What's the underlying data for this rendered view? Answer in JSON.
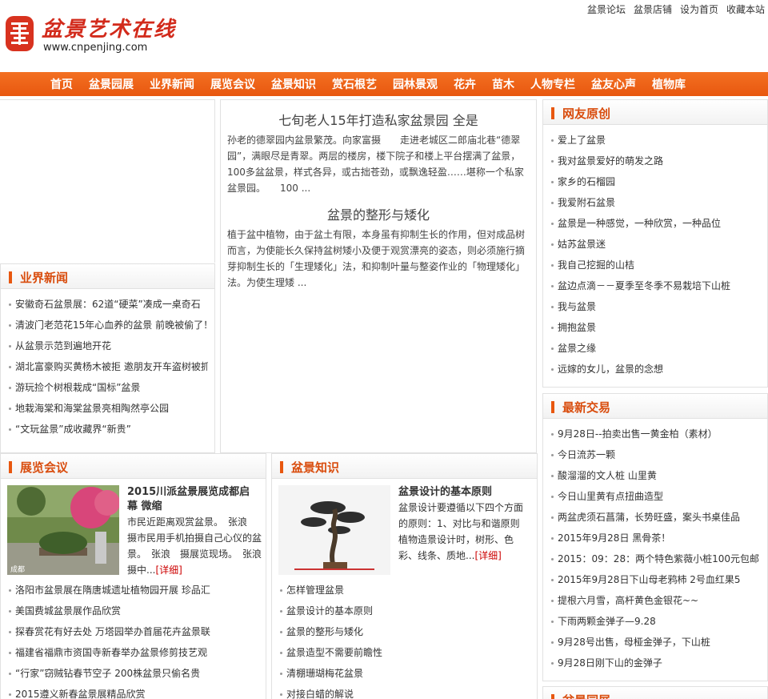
{
  "site": {
    "logo_text": "盆景艺术在线",
    "logo_url": "www.cnpenjing.com",
    "top_links": [
      "盆景论坛",
      "盆景店铺",
      "设为首页",
      "收藏本站"
    ]
  },
  "nav": [
    "首页",
    "盆景园展",
    "业界新闻",
    "展览会议",
    "盆景知识",
    "赏石根艺",
    "园林景观",
    "花卉",
    "苗木",
    "人物专栏",
    "盆友心声",
    "植物库"
  ],
  "center": {
    "articles": [
      {
        "title": "七旬老人15年打造私家盆景园  全是",
        "body": "孙老的德翠园内盆景繁茂。向家富摄　　走进老城区二郎庙北巷“德翠园”，满眼尽是青翠。两层的楼房，楼下院子和楼上平台摆满了盆景，100多盆盆景，样式各异，或古拙苍劲，或飘逸轻盈……堪称一个私家盆景园。　　100 ..."
      },
      {
        "title": "盆景的整形与矮化",
        "body": "植于盆中植物，由于盆土有限，本身虽有抑制生长的作用，但对成品树而言，为使能长久保持盆树矮小及便于观赏漂亮的姿态，则必须施行摘芽抑制生长的「生理矮化」法，和抑制叶量与整姿作业的「物理矮化」法。为使生理矮 ..."
      }
    ]
  },
  "industry_news": {
    "title": "业界新闻",
    "items": [
      "安徽奇石盆景展：62道“硬菜”凑成一桌奇石",
      "清波门老范花15年心血养的盆景 前晚被偷了！",
      "从盆景示范到遍地开花",
      "湖北富豪购买黄杨木被拒 邀朋友开车盗树被抓",
      "游玩捡个树根栽成“国标”盆景",
      "地栽海棠和海棠盆景亮相陶然亭公园",
      "“文玩盆景”成收藏界“新贵”"
    ]
  },
  "exhibitions": {
    "title": "展览会议",
    "feature_title": "2015川派盆景展览成都启幕 微缩",
    "feature_body": "市民近距离观赏盆景。　张浪　摄市民用手机拍摄自己心仪的盆景。　张浪　摄展览现场。　张浪　摄中...",
    "more": "[详细]",
    "items": [
      "洛阳市盆景展在隋唐城遗址植物园开展 珍品汇",
      "美国费城盆景展作品欣赏",
      "探春赏花有好去处 万塔园举办首届花卉盆景联",
      "福建省福鼎市资国寺新春举办盆景修剪技艺观",
      "“行家”窃贼钻春节空子 200株盆景只偷名贵",
      "2015遵义新春盆景展精品欣赏"
    ]
  },
  "knowledge": {
    "title": "盆景知识",
    "feature_title": "盆景设计的基本原则",
    "feature_body": "盆景设计要遵循以下四个方面的原则：1、对比与和谐原则 植物造景设计时，树形、色彩、线条、质地...",
    "more": "[详细]",
    "items": [
      "怎样管理盆景",
      "盆景设计的基本原则",
      "盆景的整形与矮化",
      "盆景造型不需要前瞻性",
      "清棚珊瑚梅花盆景",
      "对接白蜡的解说"
    ]
  },
  "netizen": {
    "title": "网友原创",
    "items": [
      "爱上了盆景",
      "我对盆景爱好的萌发之路",
      "家乡的石榴园",
      "我爱附石盆景",
      "盆景是一种感觉，一种欣赏，一种品位",
      "姑苏盆景迷",
      "我自己挖掘的山桔",
      "盆边点滴－－夏季至冬季不易栽培下山桩",
      "我与盆景",
      "拥抱盆景",
      "盆景之缘",
      "远嫁的女儿，盆景的念想"
    ]
  },
  "trade": {
    "title": "最新交易",
    "items": [
      "9月28日--拍卖出售一黄金柏（素材）",
      "今日流苏一颗",
      "酸溜溜的文人桩 山里黄",
      "今日山里黄有点扭曲造型",
      "两盆虎须石菖蒲，长势旺盛，案头书桌佳品",
      "2015年9月28日 黑骨茶！",
      "2015：09：28：两个特色紫薇小桩100元包邮",
      "2015年9月28日下山母老鸦柿 2号血红果5",
      "提根六月雪，高杆黄色金银花~~",
      "下雨两颗金弹子—9.28",
      "9月28号出售，母桠金弹子，下山桩",
      "9月28日刚下山的金弹子"
    ]
  },
  "garden": {
    "title": "盆景园展"
  },
  "colors": {
    "accent": "#e8570f",
    "title": "#d94d0e",
    "more": "#cc0000"
  }
}
